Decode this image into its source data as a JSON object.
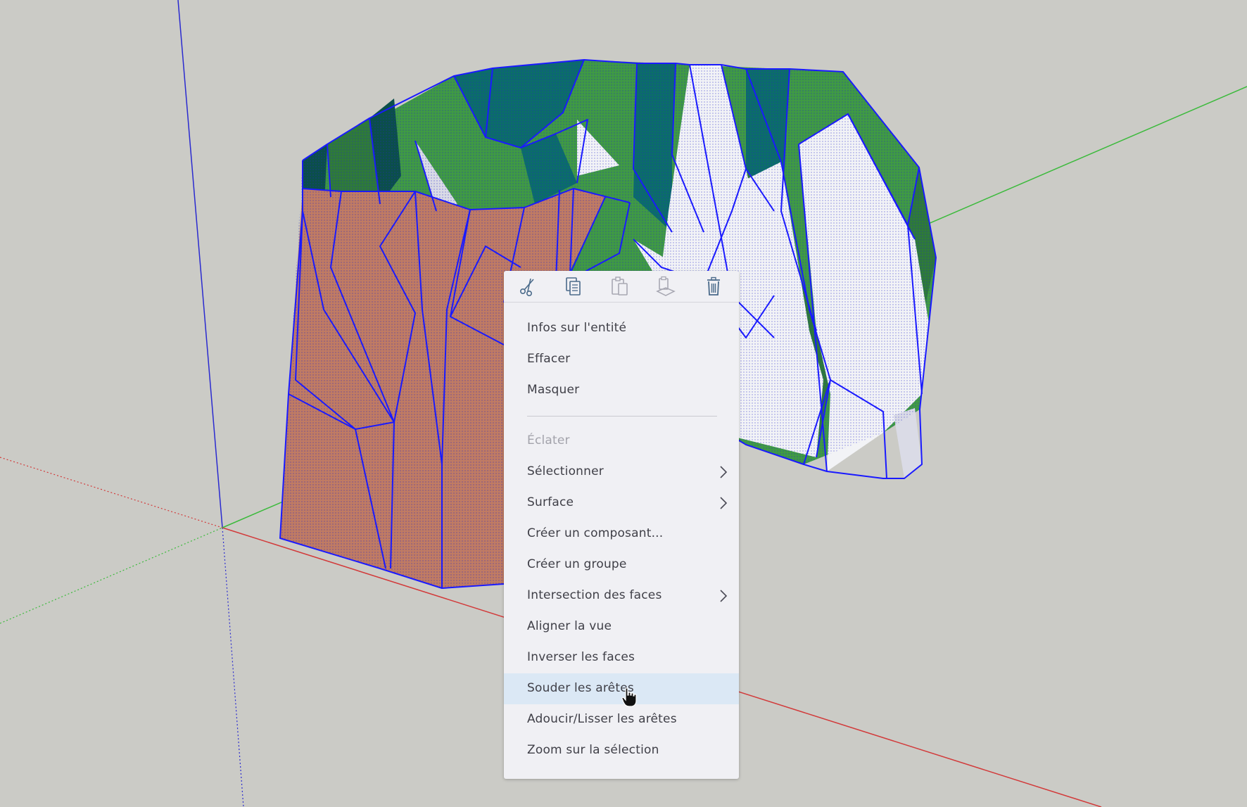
{
  "colors": {
    "background": "#cbcbc6",
    "edge": "#1a1aff",
    "face_back": "#c07b63",
    "face_green": "#3f9a44",
    "face_dark_green": "#2e7a3a",
    "face_teal": "#0b6d6a",
    "face_white": "#f2f3f6",
    "axis_red": "#d23a3a",
    "axis_green": "#3cba3c",
    "axis_blue": "#2a2ad0",
    "menu_bg": "#f0f0f4",
    "menu_highlight": "#dbe8f5"
  },
  "toolbar": [
    {
      "name": "cut",
      "icon": "scissors-icon",
      "enabled": true
    },
    {
      "name": "copy",
      "icon": "copy-icon",
      "enabled": true
    },
    {
      "name": "paste",
      "icon": "paste-icon",
      "enabled": false
    },
    {
      "name": "paste-in-place",
      "icon": "paste-in-place-icon",
      "enabled": false
    },
    {
      "name": "delete",
      "icon": "trash-icon",
      "enabled": true
    }
  ],
  "menu": {
    "items": [
      {
        "label": "Infos sur l'entité"
      },
      {
        "label": "Effacer"
      },
      {
        "label": "Masquer"
      },
      {
        "label": "Éclater",
        "disabled": true
      },
      {
        "label": "Sélectionner",
        "submenu": true
      },
      {
        "label": "Surface",
        "submenu": true
      },
      {
        "label": "Créer un composant..."
      },
      {
        "label": "Créer un groupe"
      },
      {
        "label": "Intersection des faces",
        "submenu": true
      },
      {
        "label": "Aligner la vue"
      },
      {
        "label": "Inverser les faces"
      },
      {
        "label": "Souder les arêtes",
        "highlighted": true
      },
      {
        "label": "Adoucir/Lisser les arêtes"
      },
      {
        "label": "Zoom sur la sélection"
      }
    ]
  }
}
